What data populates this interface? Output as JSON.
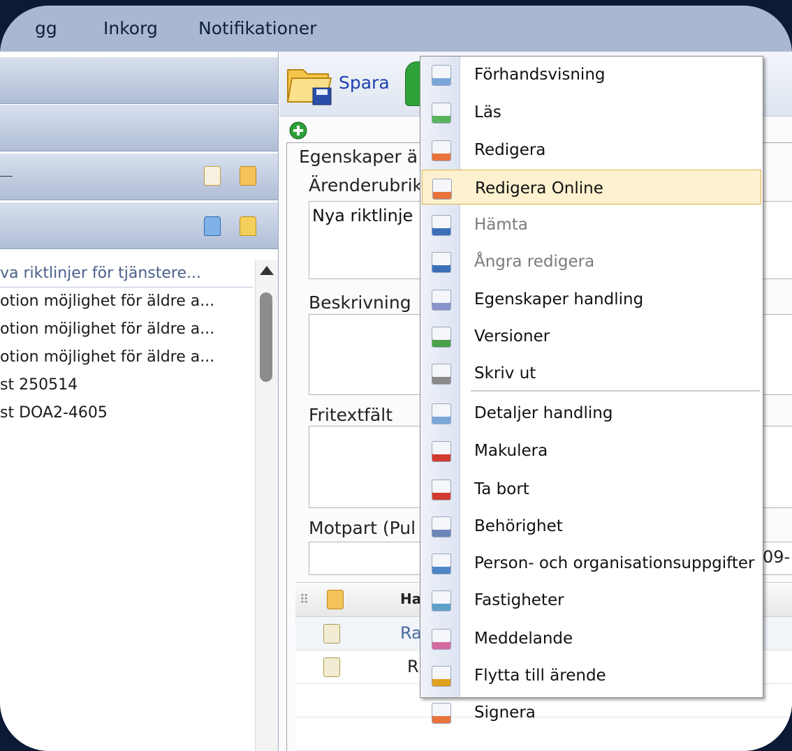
{
  "topbar": {
    "nav": [
      "gg",
      "Inkorg",
      "Notifikationer"
    ]
  },
  "left": {
    "list": [
      "va riktlinjer för tjänstere...",
      "otion möjlighet för äldre a...",
      "otion möjlighet för äldre a...",
      "otion möjlighet för äldre a...",
      "st 250514",
      "st DOA2-4605"
    ]
  },
  "toolbar": {
    "save_label": "Spara"
  },
  "form": {
    "group_title": "Egenskaper ä",
    "subject_label": "Ärenderubrik",
    "subject_value": "Nya riktlinje",
    "description_label": "Beskrivning",
    "freetext_label": "Fritextfält",
    "counterpart_label": "Motpart (Pul",
    "counterpart_extra": "09-"
  },
  "grid": {
    "header": "Ha",
    "rows": [
      "Ra",
      "Ri"
    ]
  },
  "menu": {
    "items": [
      {
        "label": "Förhandsvisning",
        "icon": "preview-icon",
        "disabled": false
      },
      {
        "label": "Läs",
        "icon": "read-icon",
        "disabled": false
      },
      {
        "label": "Redigera",
        "icon": "edit-icon",
        "disabled": false
      },
      {
        "label": "Redigera Online",
        "icon": "edit-online-icon",
        "disabled": false,
        "highlighted": true
      },
      {
        "label": "Hämta",
        "icon": "fetch-icon",
        "disabled": true
      },
      {
        "label": "Ångra redigera",
        "icon": "undo-edit-icon",
        "disabled": true
      },
      {
        "label": "Egenskaper handling",
        "icon": "properties-icon",
        "disabled": false
      },
      {
        "label": "Versioner",
        "icon": "versions-icon",
        "disabled": false
      },
      {
        "label": "Skriv ut",
        "icon": "printer-icon",
        "disabled": false
      },
      {
        "label": "Detaljer handling",
        "icon": "details-icon",
        "disabled": false
      },
      {
        "label": "Makulera",
        "icon": "cancel-document-icon",
        "disabled": false
      },
      {
        "label": "Ta bort",
        "icon": "delete-icon",
        "disabled": false
      },
      {
        "label": "Behörighet",
        "icon": "permission-icon",
        "disabled": false
      },
      {
        "label": "Person- och organisationsuppgifter",
        "icon": "people-icon",
        "disabled": false
      },
      {
        "label": "Fastigheter",
        "icon": "property-house-icon",
        "disabled": false
      },
      {
        "label": "Meddelande",
        "icon": "message-icon",
        "disabled": false
      },
      {
        "label": "Flytta till ärende",
        "icon": "move-to-case-icon",
        "disabled": false
      },
      {
        "label": "Signera",
        "icon": "sign-icon",
        "disabled": false
      }
    ]
  }
}
